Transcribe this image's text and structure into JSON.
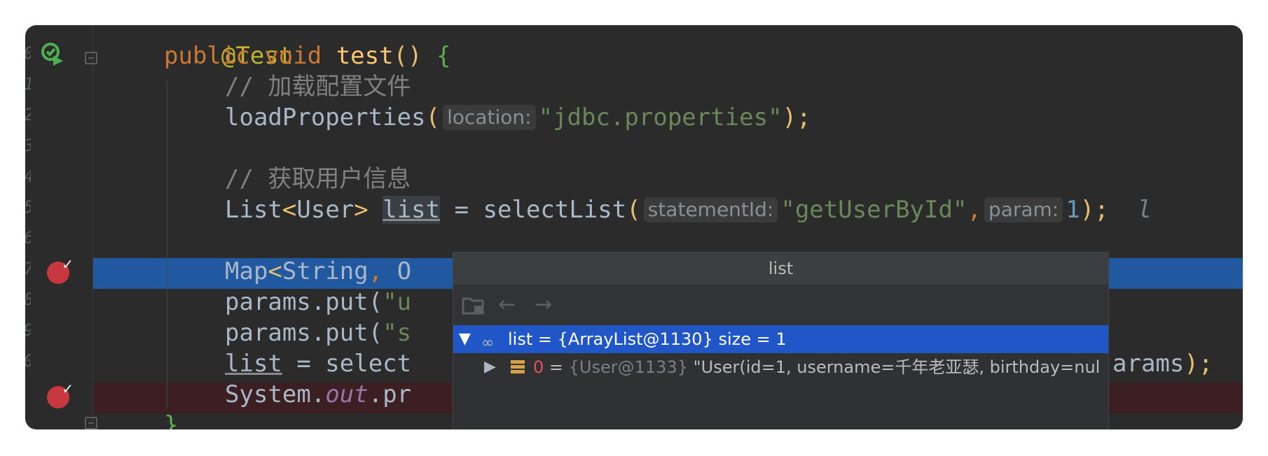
{
  "editor": {
    "lines": [
      {
        "num": "",
        "annotation": "@Test"
      },
      {
        "num": "0",
        "kw1": "public",
        "kw2": "void",
        "fn": "test",
        "paren": "()",
        "brace": "{"
      },
      {
        "num": "1",
        "comment": "// 加载配置文件"
      },
      {
        "num": "2",
        "call": "loadProperties",
        "hint": "location:",
        "str": "\"jdbc.properties\"",
        "end": ");"
      },
      {
        "num": "3"
      },
      {
        "num": "4",
        "comment": "// 获取用户信息"
      },
      {
        "num": "5",
        "type1": "List",
        "lt": "<",
        "type2": "User",
        "gt": ">",
        "var": "list",
        "eq": " = ",
        "call": "selectList",
        "hint1": "statementId:",
        "str": "\"getUserById\"",
        "comma": ",",
        "hint2": "param:",
        "num_val": "1",
        "end": ");",
        "trail": "l"
      },
      {
        "num": "6"
      },
      {
        "num": "7",
        "type1": "Map",
        "lt": "<",
        "type2": "String",
        "comma": ",",
        "type3": " O"
      },
      {
        "num": "8",
        "obj": "params",
        "dot": ".put(",
        "str": "\"u"
      },
      {
        "num": "9",
        "obj": "params",
        "dot": ".put(",
        "str": "\"s"
      },
      {
        "num": "0",
        "var": "list",
        "rest": " = select",
        "tail": "arams",
        "end": ");"
      },
      {
        "num": "1",
        "obj": "System",
        "dot": ".",
        "field": "out",
        "rest": ".pr"
      },
      {
        "num": "",
        "brace": "}"
      }
    ]
  },
  "debug_popup": {
    "title": "list",
    "toolbar": {
      "back_icon": "arrow-left-icon",
      "forward_icon": "arrow-right-icon"
    },
    "rows": [
      {
        "name": "list",
        "eq": " = ",
        "value": "{ArrayList@1130}",
        "extra": "  size = 1"
      },
      {
        "index": "0",
        "eq": " = ",
        "ref": "{User@1133}",
        "value": " \"User(id=1, username=千年老亚瑟, birthday=nul"
      }
    ]
  },
  "colors": {
    "accent_selection": "#2056c8",
    "current_line": "#2159a0",
    "breakpoint": "#c7373f"
  }
}
